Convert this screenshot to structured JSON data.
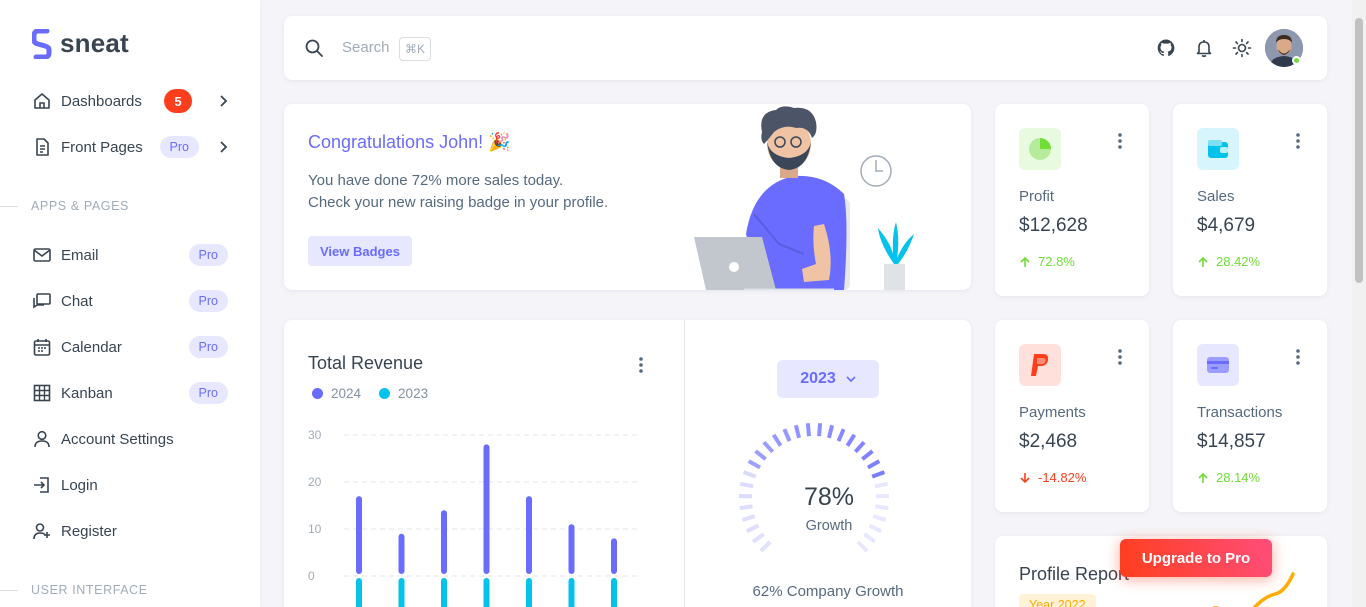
{
  "brand": {
    "name": "sneat"
  },
  "sidebar": {
    "items": [
      {
        "label": "Dashboards",
        "badge": "5"
      },
      {
        "label": "Front Pages",
        "badge": "Pro"
      }
    ],
    "section_apps": "APPS & PAGES",
    "apps": [
      {
        "label": "Email",
        "badge": "Pro"
      },
      {
        "label": "Chat",
        "badge": "Pro"
      },
      {
        "label": "Calendar",
        "badge": "Pro"
      },
      {
        "label": "Kanban",
        "badge": "Pro"
      },
      {
        "label": "Account Settings"
      },
      {
        "label": "Login"
      },
      {
        "label": "Register"
      }
    ],
    "section_ui": "USER INTERFACE"
  },
  "navbar": {
    "search_placeholder": "Search",
    "shortcut": "⌘K"
  },
  "congrats": {
    "title": "Congratulations John! 🎉",
    "line1": "You have done 72% more sales today.",
    "line2": "Check your new raising badge in your profile.",
    "button": "View Badges"
  },
  "stats": {
    "profit": {
      "label": "Profit",
      "value": "$12,628",
      "change": "72.8%"
    },
    "sales": {
      "label": "Sales",
      "value": "$4,679",
      "change": "28.42%"
    },
    "payments": {
      "label": "Payments",
      "value": "$2,468",
      "change": "-14.82%"
    },
    "transactions": {
      "label": "Transactions",
      "value": "$14,857",
      "change": "28.14%"
    }
  },
  "revenue": {
    "title": "Total Revenue",
    "year_button": "2023",
    "growth_percent": "78%",
    "growth_label": "Growth",
    "company_growth": "62% Company Growth"
  },
  "profile_report": {
    "title": "Profile Report",
    "year_badge": "Year 2022"
  },
  "upgrade": {
    "label": "Upgrade to Pro"
  },
  "colors": {
    "primary": "#696cff",
    "info": "#03c3ec",
    "success": "#71dd37",
    "danger": "#ff3e1d",
    "warning": "#ffab00"
  },
  "chart_data": {
    "type": "bar",
    "title": "Total Revenue",
    "categories": [
      "",
      "",
      "",
      "",
      "",
      "",
      ""
    ],
    "series": [
      {
        "name": "2024",
        "values": [
          17,
          9,
          14,
          28,
          17,
          11,
          8
        ]
      },
      {
        "name": "2023",
        "values": [
          -2,
          -2,
          -2,
          -2,
          -2,
          -2,
          -2
        ]
      }
    ],
    "yticks": [
      "30",
      "20",
      "10",
      "0"
    ],
    "ylim": [
      -2,
      30
    ],
    "legend": "top-left",
    "grid": true
  },
  "growth_gauge": {
    "value": 78
  }
}
